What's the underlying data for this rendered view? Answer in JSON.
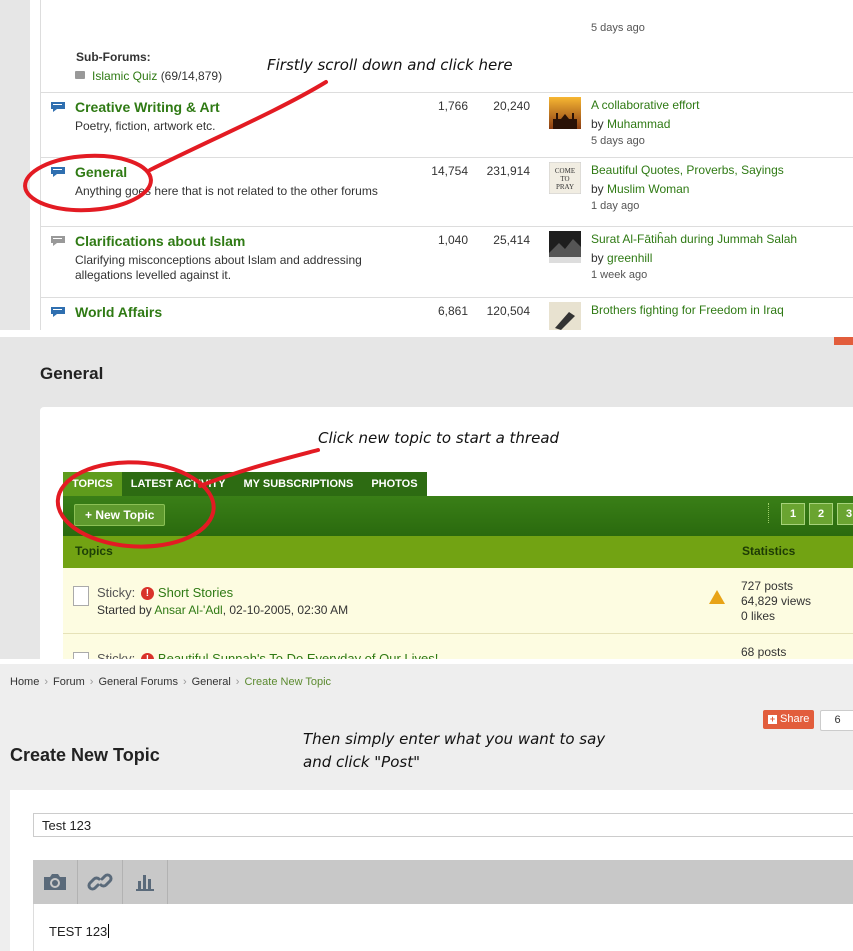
{
  "forum_list": {
    "top_time": "5 days ago",
    "subforums_label": "Sub-Forums:",
    "subforum": {
      "name": "Islamic Quiz",
      "count": "(69/14,879)"
    },
    "rows": [
      {
        "title": "Creative Writing & Art",
        "desc": "Poetry, fiction, artwork etc.",
        "threads": "1,766",
        "posts": "20,240",
        "last_title": "A collaborative effort",
        "by_prefix": "by ",
        "by_user": "Muhammad",
        "time": "5 days ago"
      },
      {
        "title": "General",
        "desc": "Anything goes here that is not related to the other forums",
        "threads": "14,754",
        "posts": "231,914",
        "last_title": "Beautiful Quotes, Proverbs, Sayings",
        "by_prefix": "by ",
        "by_user": "Muslim Woman",
        "time": "1 day ago"
      },
      {
        "title": "Clarifications about Islam",
        "desc": "Clarifying misconceptions about Islam and addressing allegations levelled against it.",
        "threads": "1,040",
        "posts": "25,414",
        "last_title": "Surat Al-Fātiĥah during Jummah Salah",
        "by_prefix": "by ",
        "by_user": "greenhill",
        "time": "1 week ago"
      },
      {
        "title": "World Affairs",
        "desc": "",
        "threads": "6,861",
        "posts": "120,504",
        "last_title": "Brothers fighting for Freedom in Iraq",
        "by_prefix": "",
        "by_user": "",
        "time": ""
      }
    ]
  },
  "general_panel": {
    "title": "General",
    "tabs": [
      "Topics",
      "Latest Activity",
      "My Subscriptions",
      "Photos"
    ],
    "new_topic_label": "+ New Topic",
    "pages": [
      "1",
      "2",
      "3"
    ],
    "col_topics": "Topics",
    "col_stats": "Statistics",
    "topics": [
      {
        "prefix": "Sticky:",
        "title": "Short Stories",
        "started_prefix": "Started by ",
        "author": "Ansar Al-'Adl",
        "date": ", 02-10-2005, 02:30 AM",
        "posts": "727 posts",
        "views": "64,829 views",
        "likes": "0 likes"
      },
      {
        "prefix": "Sticky:",
        "title": "Beautiful Sunnah's To Do Everyday of Our Lives!",
        "posts": "68 posts"
      }
    ]
  },
  "create_panel": {
    "breadcrumb": [
      "Home",
      "Forum",
      "General Forums",
      "General",
      "Create New Topic"
    ],
    "share_label": "Share",
    "share_count": "6",
    "title": "Create New Topic",
    "subject_value": "Test 123",
    "editor_text": "TEST 123",
    "tools": [
      "camera-icon",
      "link-icon",
      "bar-chart-icon"
    ]
  },
  "annotations": {
    "a1": "Firstly scroll down and click here",
    "a2": "Click new topic to start a thread",
    "a3_line1": "Then simply enter what you want to say",
    "a3_line2": "and click \"Post\""
  },
  "colors": {
    "forum_green": "#2f7a14",
    "tab_dark": "#2d6b12",
    "header_lime": "#72a313",
    "annotation_red": "#e31b23"
  }
}
